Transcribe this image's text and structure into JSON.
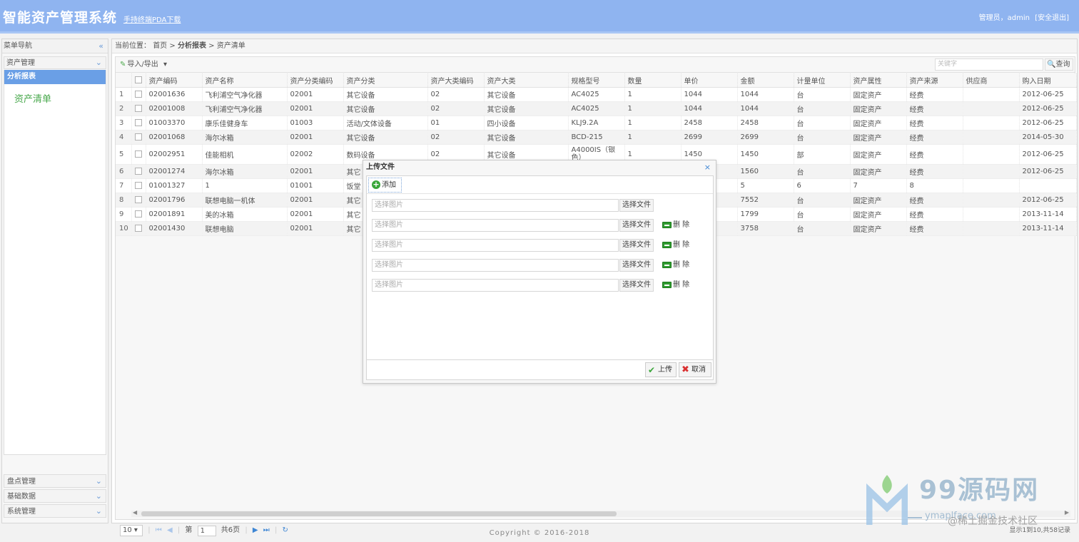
{
  "header": {
    "title": "智能资产管理系统",
    "pda_link": "手持终端PDA下载",
    "user_label": "管理员，admin",
    "logout": "[安全退出]"
  },
  "sidebar": {
    "title": "菜单导航",
    "collapse_icon": "«",
    "panels": [
      {
        "label": "资产管理"
      },
      {
        "label": "盘点管理"
      },
      {
        "label": "基础数据"
      },
      {
        "label": "系统管理"
      }
    ],
    "active_item": "分析报表",
    "link": "资产清单"
  },
  "breadcrumb": {
    "prefix": "当前位置：",
    "home": "首页",
    "sep": ">",
    "section": "分析报表",
    "page": "资产清单"
  },
  "toolbar": {
    "import_export": "导入/导出",
    "search_placeholder": "关键字",
    "search_button": "查询"
  },
  "table": {
    "columns": [
      "资产编码",
      "资产名称",
      "资产分类编码",
      "资产分类",
      "资产大类编码",
      "资产大类",
      "规格型号",
      "数量",
      "单价",
      "金额",
      "计量单位",
      "资产属性",
      "资产来源",
      "供应商",
      "购入日期"
    ],
    "rows": [
      [
        "1",
        "02001636",
        "飞利浦空气净化器",
        "02001",
        "其它设备",
        "02",
        "其它设备",
        "AC4025",
        "1",
        "1044",
        "1044",
        "台",
        "固定资产",
        "经费",
        "",
        "2012-06-25"
      ],
      [
        "2",
        "02001008",
        "飞利浦空气净化器",
        "02001",
        "其它设备",
        "02",
        "其它设备",
        "AC4025",
        "1",
        "1044",
        "1044",
        "台",
        "固定资产",
        "经费",
        "",
        "2012-06-25"
      ],
      [
        "3",
        "01003370",
        "康乐佳健身车",
        "01003",
        "活动/文体设备",
        "01",
        "四小设备",
        "KLJ9.2A",
        "1",
        "2458",
        "2458",
        "台",
        "固定资产",
        "经费",
        "",
        "2012-06-25"
      ],
      [
        "4",
        "02001068",
        "海尔冰箱",
        "02001",
        "其它设备",
        "02",
        "其它设备",
        "BCD-215",
        "1",
        "2699",
        "2699",
        "台",
        "固定资产",
        "经费",
        "",
        "2014-05-30"
      ],
      [
        "5",
        "02002951",
        "佳能相机",
        "02002",
        "数码设备",
        "02",
        "其它设备",
        "A4000IS（银色）",
        "1",
        "1450",
        "1450",
        "部",
        "固定资产",
        "经费",
        "",
        "2012-06-25"
      ],
      [
        "6",
        "02001274",
        "海尔冰箱",
        "02001",
        "其它",
        "",
        "",
        "",
        "",
        "",
        "1560",
        "台",
        "固定资产",
        "经费",
        "",
        "2012-06-25"
      ],
      [
        "7",
        "01001327",
        "1",
        "01001",
        "饭堂",
        "",
        "",
        "",
        "",
        "",
        "5",
        "6",
        "7",
        "8",
        "",
        ""
      ],
      [
        "8",
        "02001796",
        "联想电脑一机体",
        "02001",
        "其它",
        "",
        "",
        "",
        "",
        "",
        "7552",
        "台",
        "固定资产",
        "经费",
        "",
        "2012-06-25"
      ],
      [
        "9",
        "02001891",
        "美的冰箱",
        "02001",
        "其它",
        "",
        "",
        "",
        "",
        "",
        "1799",
        "台",
        "固定资产",
        "经费",
        "",
        "2013-11-14"
      ],
      [
        "10",
        "02001430",
        "联想电脑",
        "02001",
        "其它",
        "",
        "",
        "",
        "",
        "",
        "3758",
        "台",
        "固定资产",
        "经费",
        "",
        "2013-11-14"
      ]
    ]
  },
  "pager": {
    "page_size": "10",
    "page_prefix": "第",
    "page_value": "1",
    "page_total": "共6页",
    "info": "显示1到10,共58记录"
  },
  "footer": "Copyright © 2016-2018",
  "dialog": {
    "title": "上传文件",
    "close_icon": "×",
    "add_label": "添加",
    "file_placeholder": "选择图片",
    "choose_label": "选择文件",
    "delete_label": "删 除",
    "upload_label": "上传",
    "cancel_label": "取消"
  },
  "watermark": {
    "brand": "99源码网",
    "url": "ymaplface.com",
    "dash": "—",
    "juejin": "@稀土掘金技术社区"
  },
  "colors": {
    "header_bg": "#8fb4f0",
    "active_item": "#6a9fe6",
    "link_green": "#48a84c",
    "pager_blue": "#3e86d4"
  }
}
